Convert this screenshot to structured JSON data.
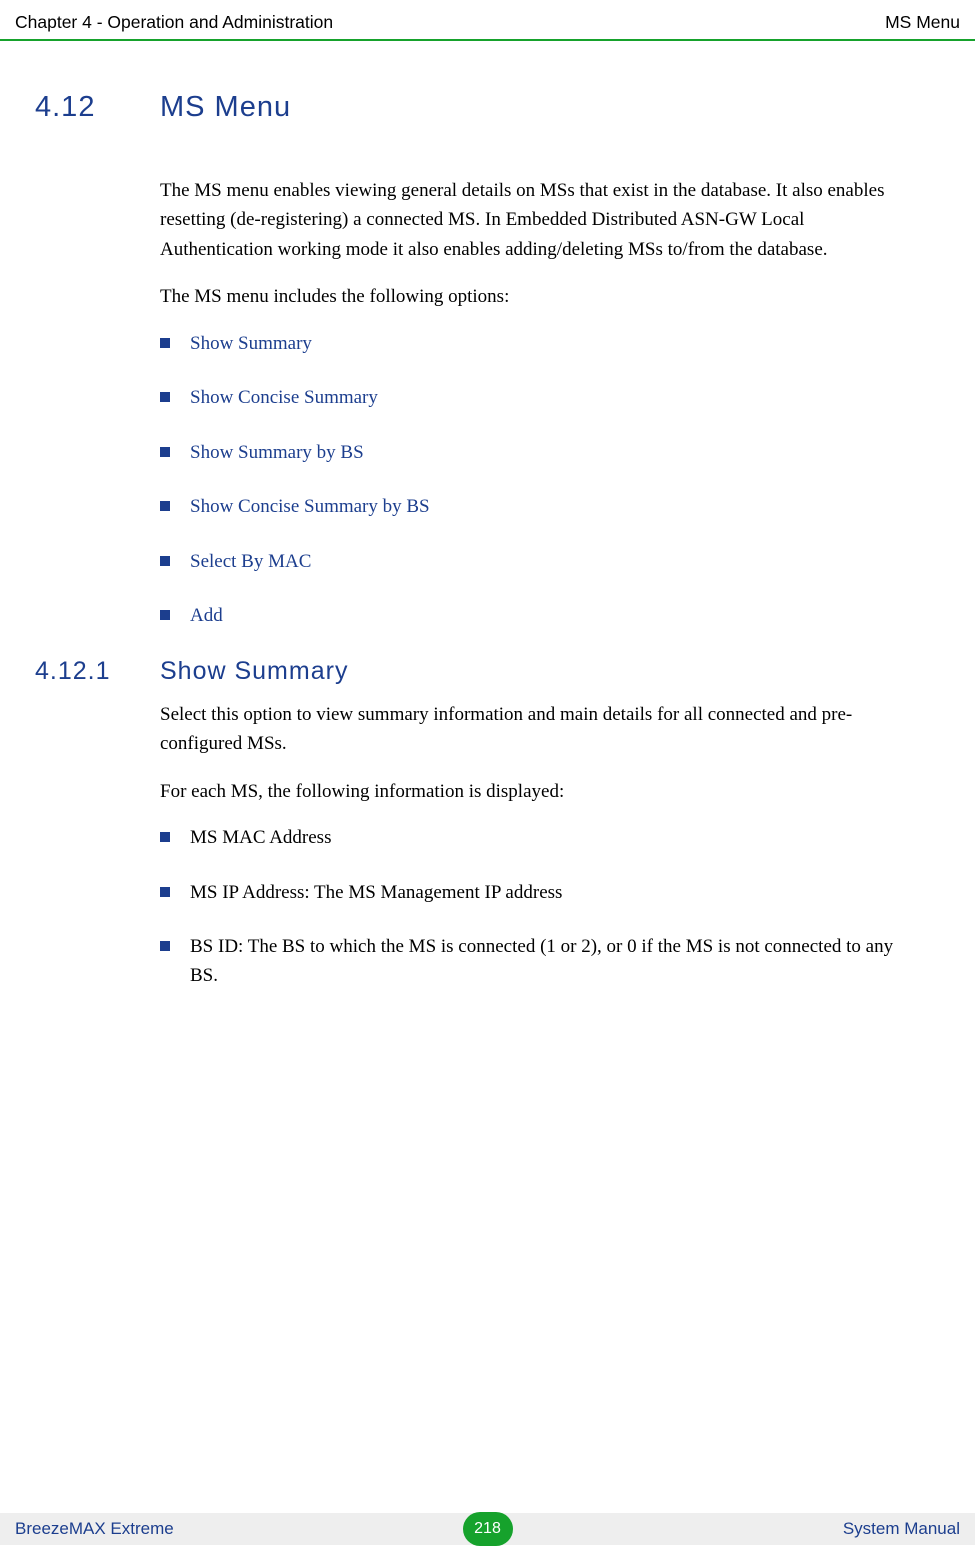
{
  "header": {
    "left": "Chapter 4 - Operation and Administration",
    "right": "MS Menu"
  },
  "section": {
    "number": "4.12",
    "title": "MS Menu",
    "intro1": "The MS menu enables viewing general details on MSs that exist in the database. It also enables resetting (de-registering) a connected MS. In Embedded Distributed ASN-GW Local Authentication working mode it also enables adding/deleting MSs to/from the database.",
    "intro2": "The MS menu includes the following options:",
    "options": [
      "Show Summary",
      "Show Concise Summary",
      "Show Summary by BS",
      "Show Concise Summary by BS",
      "Select By MAC",
      "Add"
    ]
  },
  "subsection": {
    "number": "4.12.1",
    "title": "Show Summary",
    "para1": "Select this option to view summary information and main details for all connected and pre-configured MSs.",
    "para2": "For each MS, the following information is displayed:",
    "items": [
      "MS MAC Address",
      "MS IP Address: The MS Management IP address",
      "BS ID: The BS to which the MS is connected (1 or 2), or 0 if the MS is not connected to any BS."
    ]
  },
  "footer": {
    "left": "BreezeMAX Extreme",
    "page": "218",
    "right": "System Manual"
  }
}
